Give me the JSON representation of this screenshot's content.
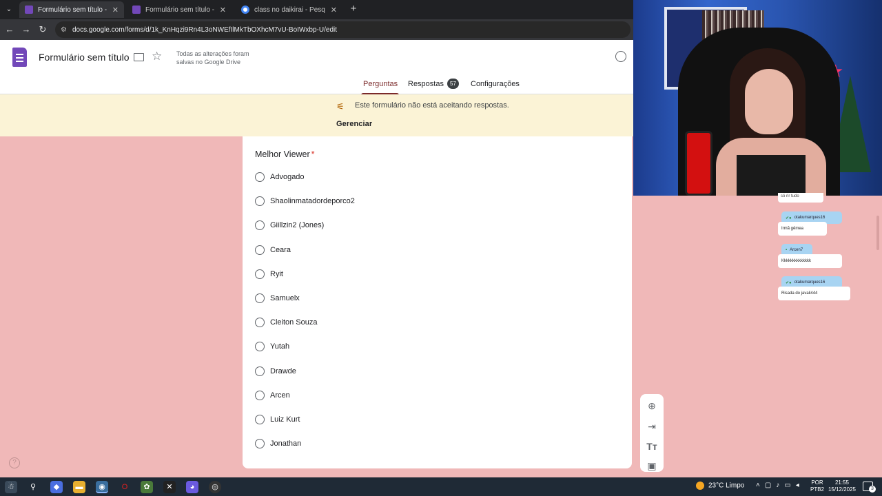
{
  "browser": {
    "tabs": [
      {
        "label": "Formulário sem título - Google",
        "active": true
      },
      {
        "label": "Formulário sem título - Google",
        "active": false
      },
      {
        "label": "class no daikirai - Pesquisa Goo",
        "active": false
      }
    ],
    "url": "docs.google.com/forms/d/1k_KnHqzi9Rn4L3oNWEfIlMkTbOXhcM7vU-BoIWxbp-U/edit"
  },
  "forms": {
    "doc_title": "Formulário sem título",
    "save_status": "Todas as alterações foram salvas no Google Drive",
    "tabs": {
      "perguntas": "Perguntas",
      "respostas": "Respostas",
      "respostas_count": "57",
      "configuracoes": "Configurações"
    },
    "banner": {
      "text": "Este formulário não está aceitando respostas.",
      "manage_label": "Gerenciar"
    },
    "question": {
      "title": "Melhor Viewer",
      "required_mark": "*",
      "options": [
        "Advogado",
        "Shaolinmatadordeporco2",
        "Giillzin2 (Jones)",
        "Ceara",
        "Ryit",
        "Samuelx",
        "Cleiton Souza",
        "Yutah",
        "Drawde",
        "Arcen",
        "Luiz Kurt",
        "Jonathan"
      ]
    },
    "toolbar_icons": [
      "add-question-icon",
      "import-questions-icon",
      "add-title-icon",
      "add-image-icon"
    ]
  },
  "chat": {
    "stub": "só rir tudo",
    "messages": [
      {
        "user": "otakumarques16",
        "text": "Irmã gêmea"
      },
      {
        "user": "Arcen7",
        "text": "Kkkkkkkkkkkkkk"
      },
      {
        "user": "otakumarques16",
        "text": "Risada do javali444"
      }
    ]
  },
  "taskbar": {
    "weather": "23°C  Limpo",
    "lang": "POR",
    "lang2": "PTB2",
    "time": "21:55",
    "date": "15/12/2025",
    "notifications": "3"
  }
}
